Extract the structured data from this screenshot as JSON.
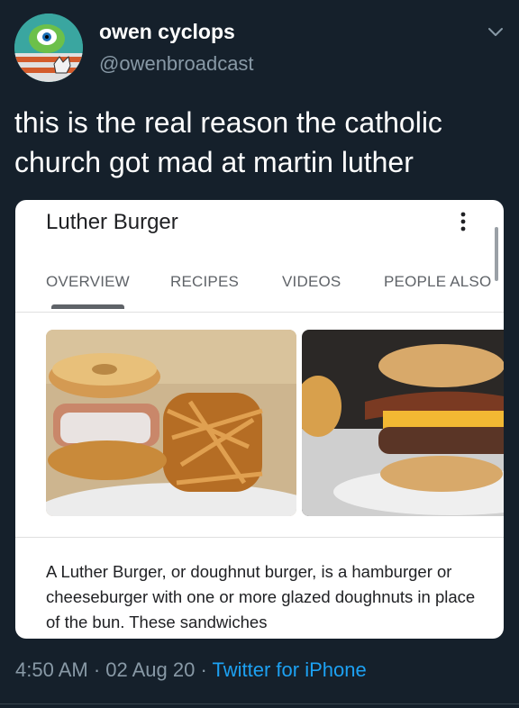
{
  "user": {
    "display_name": "owen cyclops",
    "handle": "@owenbroadcast"
  },
  "tweet": {
    "text": "this is the real reason the catholic church got mad at martin luther",
    "timestamp": "4:50 AM · 02 Aug 20 · ",
    "source": "Twitter for iPhone"
  },
  "card": {
    "title": "Luther Burger",
    "tabs": [
      {
        "label": "OVERVIEW",
        "active": true
      },
      {
        "label": "RECIPES",
        "active": false
      },
      {
        "label": "VIDEOS",
        "active": false
      },
      {
        "label": "PEOPLE ALSO",
        "active": false
      }
    ],
    "description": "A Luther Burger, or doughnut burger, is a hamburger or cheeseburger with one or more glazed doughnuts in place of the bun. These sandwiches"
  },
  "icons": {
    "caret": "chevron-down-icon",
    "menu": "more-vertical-icon"
  },
  "colors": {
    "background": "#15202b",
    "link": "#1da1f2",
    "secondary_text": "#8899a6"
  }
}
